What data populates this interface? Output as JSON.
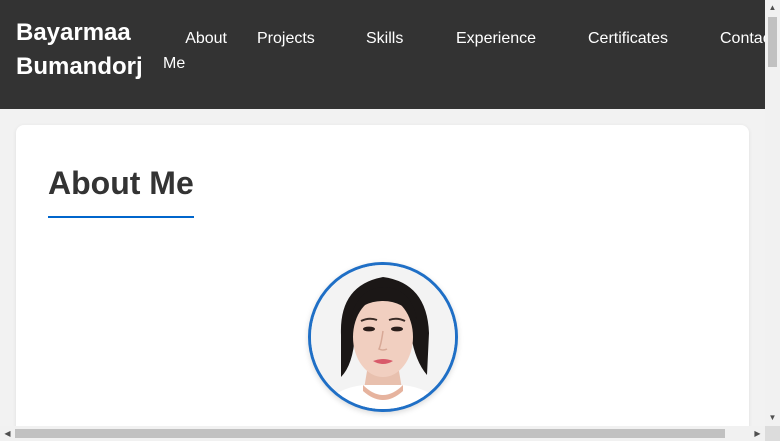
{
  "header": {
    "brand": "Bayarmaa Bumandorj",
    "nav": [
      {
        "label_line1": "About",
        "label_line2": "Me"
      },
      {
        "label": "Projects"
      },
      {
        "label": "Skills"
      },
      {
        "label": "Experience"
      },
      {
        "label": "Certificates"
      },
      {
        "label": "Contac"
      }
    ]
  },
  "about": {
    "title": "About Me"
  },
  "colors": {
    "header_bg": "#333333",
    "accent": "#0066cc",
    "page_bg": "#f2f2f2",
    "card_bg": "#ffffff"
  },
  "icons": {
    "scroll_up": "up-arrow-icon",
    "scroll_down": "down-arrow-icon",
    "scroll_left": "left-arrow-icon",
    "scroll_right": "right-arrow-icon"
  }
}
